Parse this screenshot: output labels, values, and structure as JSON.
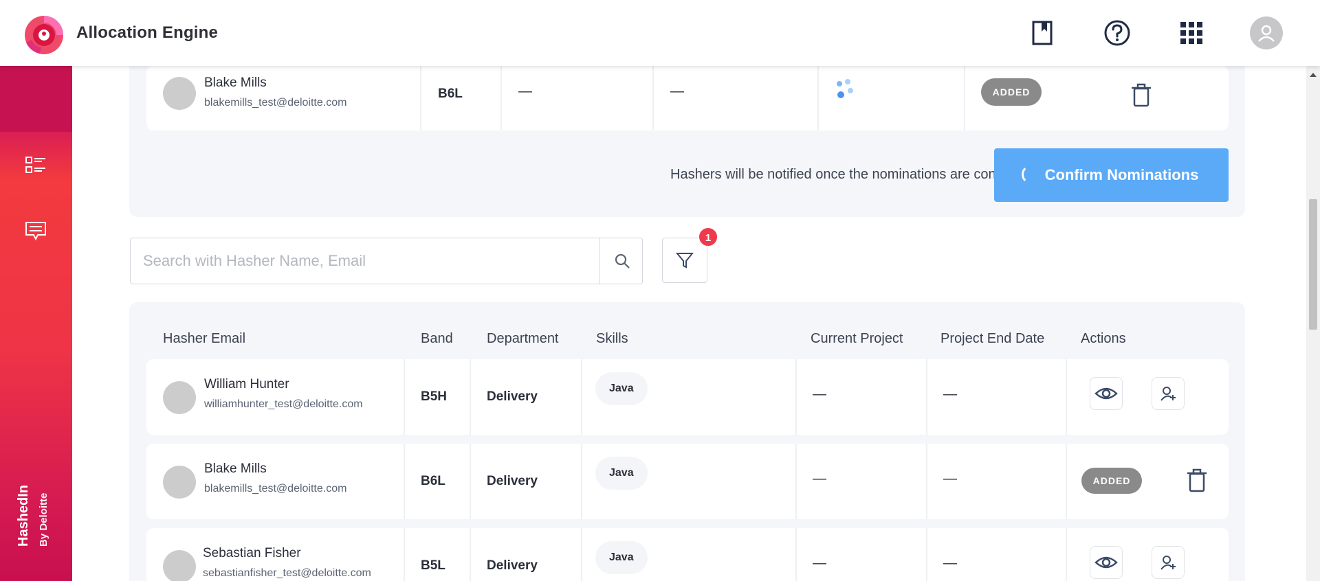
{
  "app": {
    "title": "Allocation Engine"
  },
  "header_icons": [
    "bookmark-icon",
    "help-icon",
    "apps-grid-icon",
    "user-avatar-icon"
  ],
  "sidebar": {
    "items": [
      {
        "icon": "list-icon"
      },
      {
        "icon": "feedback-icon"
      }
    ],
    "brand": {
      "main": "HashedIn",
      "sub": "By Deloitte"
    }
  },
  "nominations": {
    "row": {
      "name": "Blake Mills",
      "email": "blakemills_test@deloitte.com",
      "band": "B6L",
      "current_project": "—",
      "end_date": "—",
      "status": "ADDED"
    },
    "notice": "Hashers will be notified once the nominations are confirmed",
    "confirm_label": "Confirm Nominations"
  },
  "search": {
    "placeholder": "Search with Hasher Name, Email"
  },
  "filter": {
    "badge_count": "1"
  },
  "table": {
    "headers": [
      "Hasher Email",
      "Band",
      "Department",
      "Skills",
      "Current Project",
      "Project End Date",
      "Actions"
    ],
    "rows": [
      {
        "name": "William Hunter",
        "email": "williamhunter_test@deloitte.com",
        "band": "B5H",
        "department": "Delivery",
        "skill": "Java",
        "current_project": "—",
        "end_date": "—",
        "status": ""
      },
      {
        "name": "Blake Mills",
        "email": "blakemills_test@deloitte.com",
        "band": "B6L",
        "department": "Delivery",
        "skill": "Java",
        "current_project": "—",
        "end_date": "—",
        "status": "ADDED"
      },
      {
        "name": "Sebastian Fisher",
        "email": "sebastianfisher_test@deloitte.com",
        "band": "B5L",
        "department": "Delivery",
        "skill": "Java",
        "current_project": "—",
        "end_date": "—",
        "status": ""
      }
    ]
  },
  "colors": {
    "accent": "#5aaaf8",
    "brand_red": "#ef3a4e",
    "badge_gray": "#8a8a8a"
  }
}
